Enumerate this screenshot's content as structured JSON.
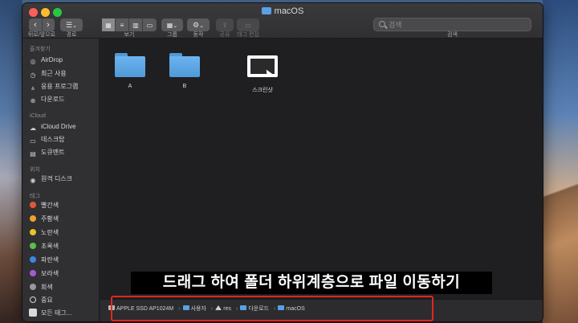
{
  "window": {
    "title": "macOS",
    "colors": {
      "close": "#fc5f57",
      "minimize": "#fdbc2e",
      "maximize": "#28c840",
      "folder": "#5aa0e6",
      "highlight": "#e0281c"
    }
  },
  "toolbar": {
    "back_label": "뒤로/앞으로",
    "path_label": "경로",
    "view_label": "보기",
    "group_label": "그룹",
    "action_label": "동작",
    "share_label": "공유",
    "tag_label": "태그 편집",
    "search_label": "검색",
    "search_placeholder": "검색",
    "back_icon": "‹",
    "forward_icon": "›",
    "gear_icon": "⚙",
    "chevron_icon": "⌄"
  },
  "sidebar": {
    "favorites_header": "즐겨찾기",
    "favorites": [
      {
        "label": "AirDrop",
        "icon": "airdrop-icon"
      },
      {
        "label": "최근 사용",
        "icon": "clock-icon"
      },
      {
        "label": "응용 프로그램",
        "icon": "apps-icon"
      },
      {
        "label": "다운로드",
        "icon": "download-icon"
      }
    ],
    "icloud_header": "iCloud",
    "icloud": [
      {
        "label": "iCloud Drive",
        "icon": "cloud-icon"
      },
      {
        "label": "데스크탑",
        "icon": "desktop-icon"
      },
      {
        "label": "도큐멘트",
        "icon": "document-icon"
      }
    ],
    "location_header": "위치",
    "locations": [
      {
        "label": "원격 디스크",
        "icon": "disc-icon"
      }
    ],
    "tags_header": "태그",
    "tags": [
      {
        "label": "빨간색",
        "color": "#e0583b"
      },
      {
        "label": "주황색",
        "color": "#f0a030"
      },
      {
        "label": "노란색",
        "color": "#e8c42a"
      },
      {
        "label": "초록색",
        "color": "#5bbf4a"
      },
      {
        "label": "파란색",
        "color": "#3f86e0"
      },
      {
        "label": "보라색",
        "color": "#a55bd0"
      },
      {
        "label": "회색",
        "color": "#9a9a9c"
      },
      {
        "label": "중요",
        "color": "#d9d9d9"
      },
      {
        "label": "모든 태그...",
        "color": "#d9d9d9"
      }
    ]
  },
  "main": {
    "items": [
      {
        "label": "A",
        "type": "folder"
      },
      {
        "label": "B",
        "type": "folder"
      },
      {
        "label": "스크린샷",
        "type": "screenshot"
      }
    ]
  },
  "caption": "드래그 하여 폴더 하위계층으로 파일 이동하기",
  "pathbar": {
    "segments": [
      "APPLE SSD AP1024M",
      "사용자",
      "res",
      "다운로드",
      "macOS"
    ],
    "separator": "›"
  }
}
